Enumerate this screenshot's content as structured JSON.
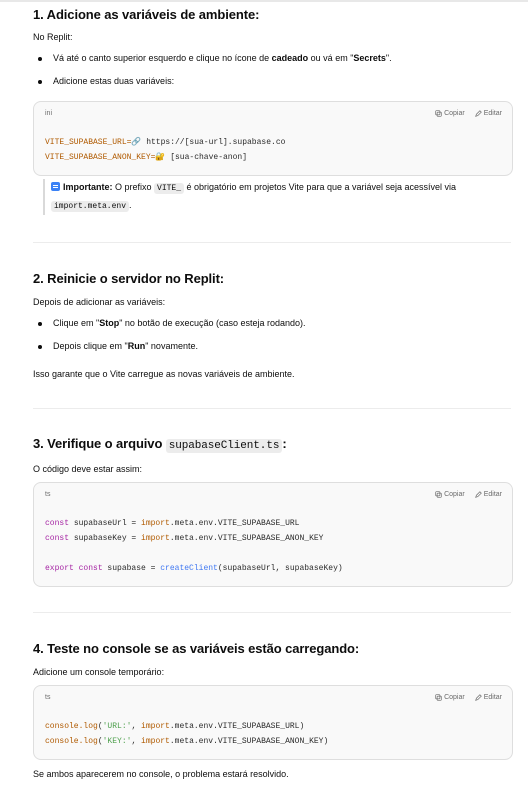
{
  "s1": {
    "title": "1. Adicione as variáveis de ambiente:",
    "intro": "No Replit:",
    "b1_pre": "Vá até o canto superior esquerdo e clique no ícone de ",
    "b1_bold1": "cadeado",
    "b1_mid": " ou vá em \"",
    "b1_bold2": "Secrets",
    "b1_post": "\".",
    "b2": "Adicione estas duas variáveis:",
    "code": {
      "lang": "ini",
      "copy": "Copiar",
      "edit": "Editar",
      "line1_key": "VITE_SUPABASE_URL=",
      "line1_icon": "🔗",
      "line1_val": " https://[sua-url].supabase.co",
      "line2_key": "VITE_SUPABASE_ANON_KEY=",
      "line2_icon": "🔐",
      "line2_val": " [sua-chave-anon]"
    },
    "note_bold": "Importante:",
    "note_pre": " O prefixo ",
    "note_code1": "VITE_",
    "note_mid": " é obrigatório em projetos Vite para que a variável seja acessível via",
    "note_code2": "import.meta.env",
    "note_end": "."
  },
  "s2": {
    "title": "2. Reinicie o servidor no Replit:",
    "intro": "Depois de adicionar as variáveis:",
    "b1_pre": "Clique em \"",
    "b1_bold": "Stop",
    "b1_post": "\" no botão de execução (caso esteja rodando).",
    "b2_pre": "Depois clique em \"",
    "b2_bold": "Run",
    "b2_post": "\" novamente.",
    "outro": "Isso garante que o Vite carregue as novas variáveis de ambiente."
  },
  "s3": {
    "title": "3. Verifique o arquivo ",
    "title_code": "supabaseClient.ts",
    "title_end": ":",
    "intro": "O código deve estar assim:",
    "code": {
      "lang": "ts",
      "copy": "Copiar",
      "edit": "Editar",
      "l1_kw": "const",
      "l1_a": " supabaseUrl = ",
      "l1_imp": "import",
      "l1_b": ".meta.env.VITE_SUPABASE_URL",
      "l2_kw": "const",
      "l2_a": " supabaseKey = ",
      "l2_imp": "import",
      "l2_b": ".meta.env.VITE_SUPABASE_ANON_KEY",
      "l3_kw1": "export",
      "l3_kw2": " const",
      "l3_a": " supabase = ",
      "l3_fn": "createClient",
      "l3_b": "(supabaseUrl, supabaseKey)"
    }
  },
  "s4": {
    "title": "4. Teste no console se as variáveis estão carregando:",
    "intro": "Adicione um console temporário:",
    "code": {
      "lang": "ts",
      "copy": "Copiar",
      "edit": "Editar",
      "l1_fn": "console.log",
      "l1_a": "(",
      "l1_str": "'URL:'",
      "l1_b": ", ",
      "l1_imp": "import",
      "l1_c": ".meta.env.VITE_SUPABASE_URL)",
      "l2_fn": "console.log",
      "l2_a": "(",
      "l2_str": "'KEY:'",
      "l2_b": ", ",
      "l2_imp": "import",
      "l2_c": ".meta.env.VITE_SUPABASE_ANON_KEY)"
    },
    "outro": "Se ambos aparecerem no console, o problema estará resolvido."
  }
}
